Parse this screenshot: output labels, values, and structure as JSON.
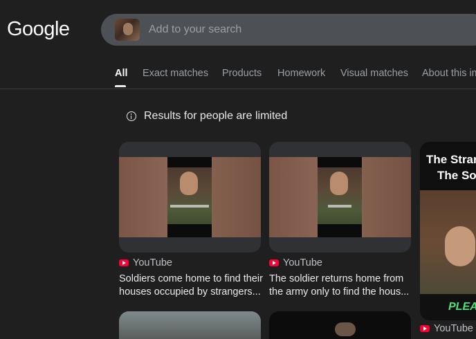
{
  "logo": "Google",
  "search": {
    "placeholder": "Add to your search"
  },
  "tabs": [
    "All",
    "Exact matches",
    "Products",
    "Homework",
    "Visual matches",
    "About this im"
  ],
  "notice": "Results for people are limited",
  "cards": [
    {
      "source": "YouTube",
      "title": "Soldiers come home to find their houses occupied by strangers..."
    },
    {
      "source": "YouTube",
      "title": "The soldier returns home from the army only to find the hous..."
    }
  ],
  "card3": {
    "text_line1": "The Stran",
    "text_line2": "The So",
    "caption": "PLEA",
    "source": "YouTube"
  },
  "colors": {
    "background": "#1f1f1f",
    "youtube_red": "#ff0033",
    "caption_green": "#4fe07a"
  }
}
